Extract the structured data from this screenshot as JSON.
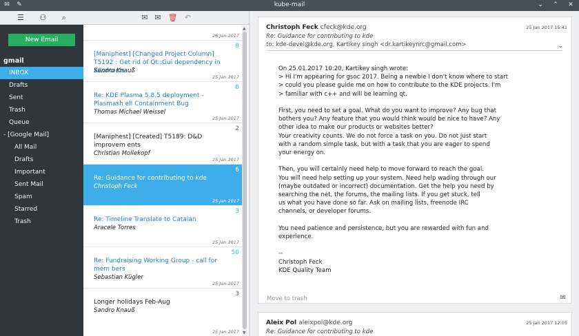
{
  "window": {
    "title": "kube-mail"
  },
  "sidebar": {
    "new_email": "New Email",
    "account": "gmail",
    "folders": [
      {
        "label": "INBOX",
        "kind": "root",
        "selected": true
      },
      {
        "label": "Drafts",
        "kind": "root"
      },
      {
        "label": "Sent",
        "kind": "root"
      },
      {
        "label": "Trash",
        "kind": "root"
      },
      {
        "label": "Queue",
        "kind": "root"
      },
      {
        "label": "- [Google Mail]",
        "kind": "group"
      },
      {
        "label": "All Mail",
        "kind": "sub"
      },
      {
        "label": "Drafts",
        "kind": "sub"
      },
      {
        "label": "Important",
        "kind": "sub"
      },
      {
        "label": "Sent Mail",
        "kind": "sub"
      },
      {
        "label": "Spam",
        "kind": "sub"
      },
      {
        "label": "Starred",
        "kind": "sub"
      },
      {
        "label": "Trash",
        "kind": "sub"
      }
    ]
  },
  "list": {
    "items": [
      {
        "count": "",
        "subject": "",
        "sender": "",
        "date": "26 Jan 2017",
        "unread": false
      },
      {
        "count": "8",
        "subject": "[Maniphest] [Changed Project Column] T5192 : Get rid of Qt::Gui dependency in KContacts",
        "sender": "Sandro Knauß",
        "date": "25 Jan 2017",
        "unread": true
      },
      {
        "count": "8",
        "subject": "Re: KDE Plasma 5.8.5 deployment - Plasmash ell Containment Bug",
        "sender": "Thomas Michael Weissel",
        "date": "25 Jan 2017",
        "unread": true
      },
      {
        "count": "2",
        "subject": "[Maniphest] [Created] T5189: D&D improvem ents",
        "sender": "Christian Mollekopf",
        "date": "25 Jan 2017",
        "unread": false
      },
      {
        "count": "6",
        "subject": "Re: Guidance for contributing to kde",
        "sender": "Christoph Feck",
        "date": "25 Jan 2017",
        "unread": true,
        "selected": true
      },
      {
        "count": "3",
        "subject": "Re: Timeline Translate to Catalan",
        "sender": "Aracele Torres",
        "date": "25 Jan 2017",
        "unread": true
      },
      {
        "count": "50",
        "subject": "Re: Fundraising Working Group - call for mem bers",
        "sender": "Sebastian Kügler",
        "date": "25 Jan 2017",
        "unread": true
      },
      {
        "count": "3",
        "subject": "Longer holidays Feb-Aug",
        "sender": "Sandro Knauß",
        "date": "25 Jan 2017",
        "unread": false
      }
    ]
  },
  "reader": {
    "message1": {
      "from_name": "Christoph Feck",
      "from_addr": "cfeck@kde.org",
      "date": "25 Jan 2017 15:41",
      "subject": "Re: Guidance for contributing to kde",
      "to": "to: kde-devel@kde.org, Kartikey singh <dr.kartikeynrc@gmail.com>",
      "body": [
        "On 25.01.2017 10:20, Kartikey singh wrote:",
        "> Hi I'm appearing for gsoc 2017. Being a newbie  I don't know where to start",
        "> could you please guide me on how to contribute to the KDE projects. I'm",
        "> familiar with c++ and will be learning qt.",
        "",
        "First, you need to set a goal. What do you want to improve? Any bug that",
        "bothers you? Any feature that you would think would be nice to have? Any",
        "other idea to make our products or websites better?",
        "Your creativity counts. We do not force a task on you. Do not just start",
        "with a random simple task, but with a task that you are eager to spend",
        "your energy on.",
        "",
        "Then, you will certainly need help to move forward to reach the goal.",
        "You will need help setting up your system. Need help wading through our",
        "(maybe outdated or incorrect) documentation. Get the help you need by",
        "searching the net, the forums, the mailing lists. If you get stuck, tell",
        "us what you have done so far. Ask on mailing lists, freenode IRC",
        "channels, or developer forums.",
        "",
        "You need patience and persistence, but you are rewarded with fun and",
        "experience.",
        "",
        "--",
        "Christoph Feck",
        "KDE Quality Team"
      ],
      "move_to_trash": "Move to trash"
    },
    "message2": {
      "from_name": "Aleix Pol",
      "from_addr": "aleixpol@kde.org",
      "date": "25 Jan 2017 12:05",
      "subject": "Re: Guidance for contributing to kde"
    }
  },
  "colors": {
    "accent": "#3daee9",
    "new_email": "#27ae60",
    "sidebar_bg": "#31363b",
    "link": "#2980b9"
  }
}
